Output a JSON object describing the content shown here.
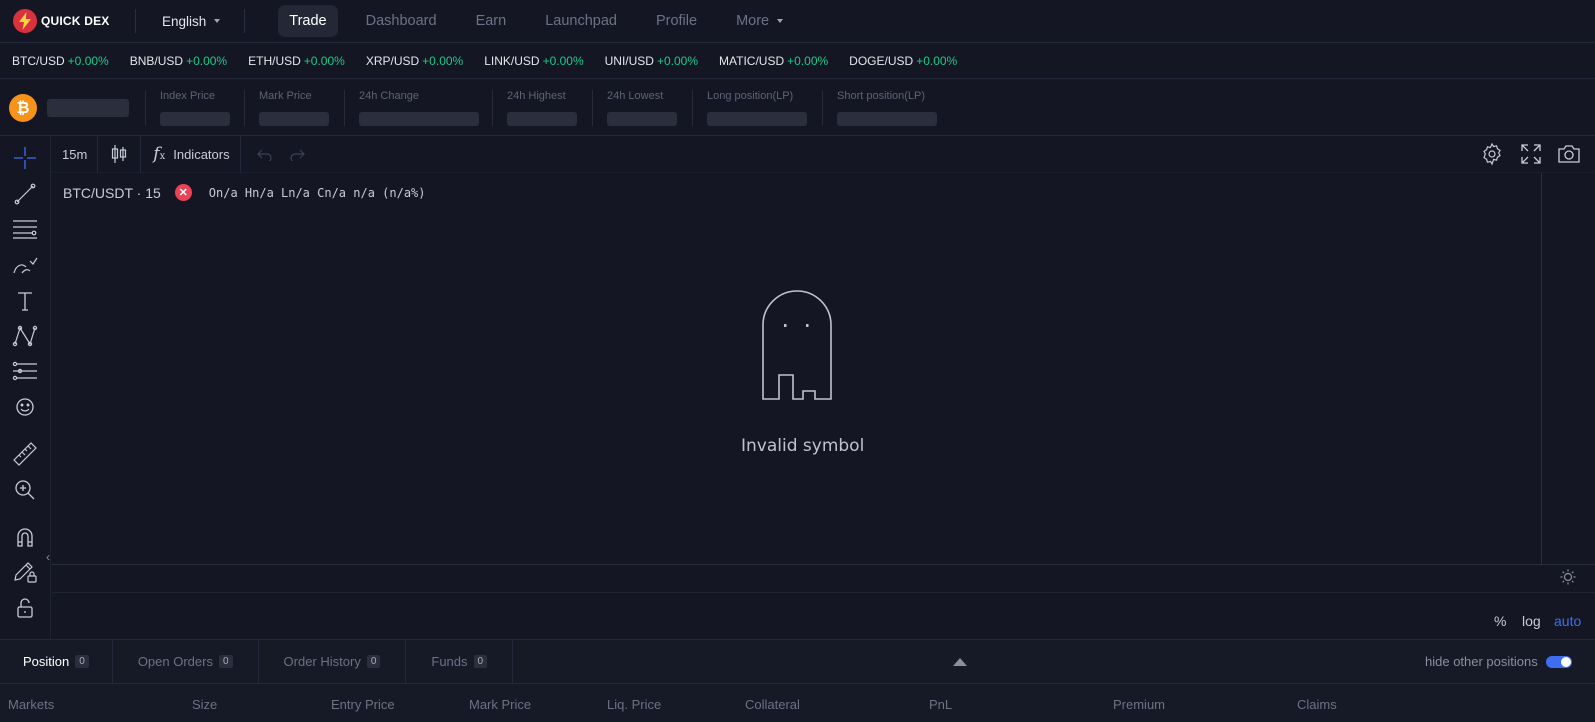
{
  "header": {
    "logo_text": "QUICK DEX",
    "language": "English",
    "nav": [
      "Trade",
      "Dashboard",
      "Earn",
      "Launchpad",
      "Profile",
      "More"
    ]
  },
  "tickers": [
    {
      "pair": "BTC/USD",
      "change": "+0.00%"
    },
    {
      "pair": "BNB/USD",
      "change": "+0.00%"
    },
    {
      "pair": "ETH/USD",
      "change": "+0.00%"
    },
    {
      "pair": "XRP/USD",
      "change": "+0.00%"
    },
    {
      "pair": "LINK/USD",
      "change": "+0.00%"
    },
    {
      "pair": "UNI/USD",
      "change": "+0.00%"
    },
    {
      "pair": "MATIC/USD",
      "change": "+0.00%"
    },
    {
      "pair": "DOGE/USD",
      "change": "+0.00%"
    }
  ],
  "stats": {
    "coin_icon": "₿",
    "labels": [
      "Index Price",
      "Mark Price",
      "24h Change",
      "24h Highest",
      "24h Lowest",
      "Long position(LP)",
      "Short position(LP)"
    ]
  },
  "chart": {
    "interval": "15m",
    "indicators_label": "Indicators",
    "symbol": "BTC/USDT · 15",
    "ohlc": "On/a Hn/a Ln/a Cn/a n/a (n/a%)",
    "invalid_message": "Invalid symbol",
    "axis_options": [
      "%",
      "log",
      "auto"
    ]
  },
  "positions": {
    "tabs": [
      {
        "label": "Position",
        "count": "0"
      },
      {
        "label": "Open Orders",
        "count": "0"
      },
      {
        "label": "Order History",
        "count": "0"
      },
      {
        "label": "Funds",
        "count": "0"
      }
    ],
    "hide_label": "hide other positions",
    "columns": [
      "Markets",
      "Size",
      "Entry Price",
      "Mark Price",
      "Liq. Price",
      "Collateral",
      "PnL",
      "Premium",
      "Claims"
    ]
  },
  "colors": {
    "accent": "#3d6df2",
    "positive": "#1ec98b",
    "danger": "#e84356",
    "btc": "#f7931a"
  }
}
